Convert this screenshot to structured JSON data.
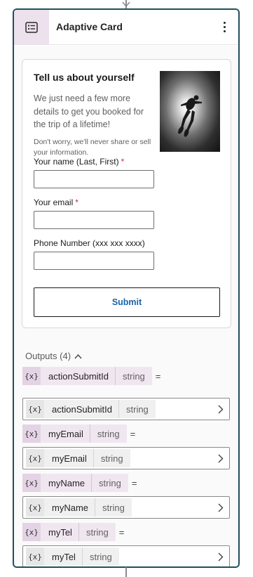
{
  "node": {
    "title": "Adaptive Card",
    "icon": "adaptive-card-icon",
    "more_icon": "more-vertical-icon"
  },
  "card": {
    "title": "Tell us about yourself",
    "description": "We just need a few more details to get you booked for the trip of a lifetime!",
    "note": "Don't worry, we'll never share or sell your information.",
    "image": "scuba-diver-image",
    "fields": [
      {
        "label": "Your name (Last, First)",
        "required": true,
        "value": ""
      },
      {
        "label": "Your email",
        "required": true,
        "value": ""
      },
      {
        "label": "Phone Number (xxx xxx xxxx)",
        "required": false,
        "value": ""
      }
    ],
    "required_marker": "*",
    "submit_label": "Submit"
  },
  "outputs": {
    "header": "Outputs (4)",
    "var_icon": "{x}",
    "equals": "=",
    "items": [
      {
        "name": "actionSubmitId",
        "type": "string",
        "selected_name": "actionSubmitId",
        "selected_type": "string"
      },
      {
        "name": "myEmail",
        "type": "string",
        "selected_name": "myEmail",
        "selected_type": "string"
      },
      {
        "name": "myName",
        "type": "string",
        "selected_name": "myName",
        "selected_type": "string"
      },
      {
        "name": "myTel",
        "type": "string",
        "selected_name": "myTel",
        "selected_type": "string"
      }
    ]
  },
  "colors": {
    "node_border": "#1f4f5f",
    "link_blue": "#1764a9",
    "required_red": "#c4314b",
    "variable_chip": "#f0e6f0"
  }
}
